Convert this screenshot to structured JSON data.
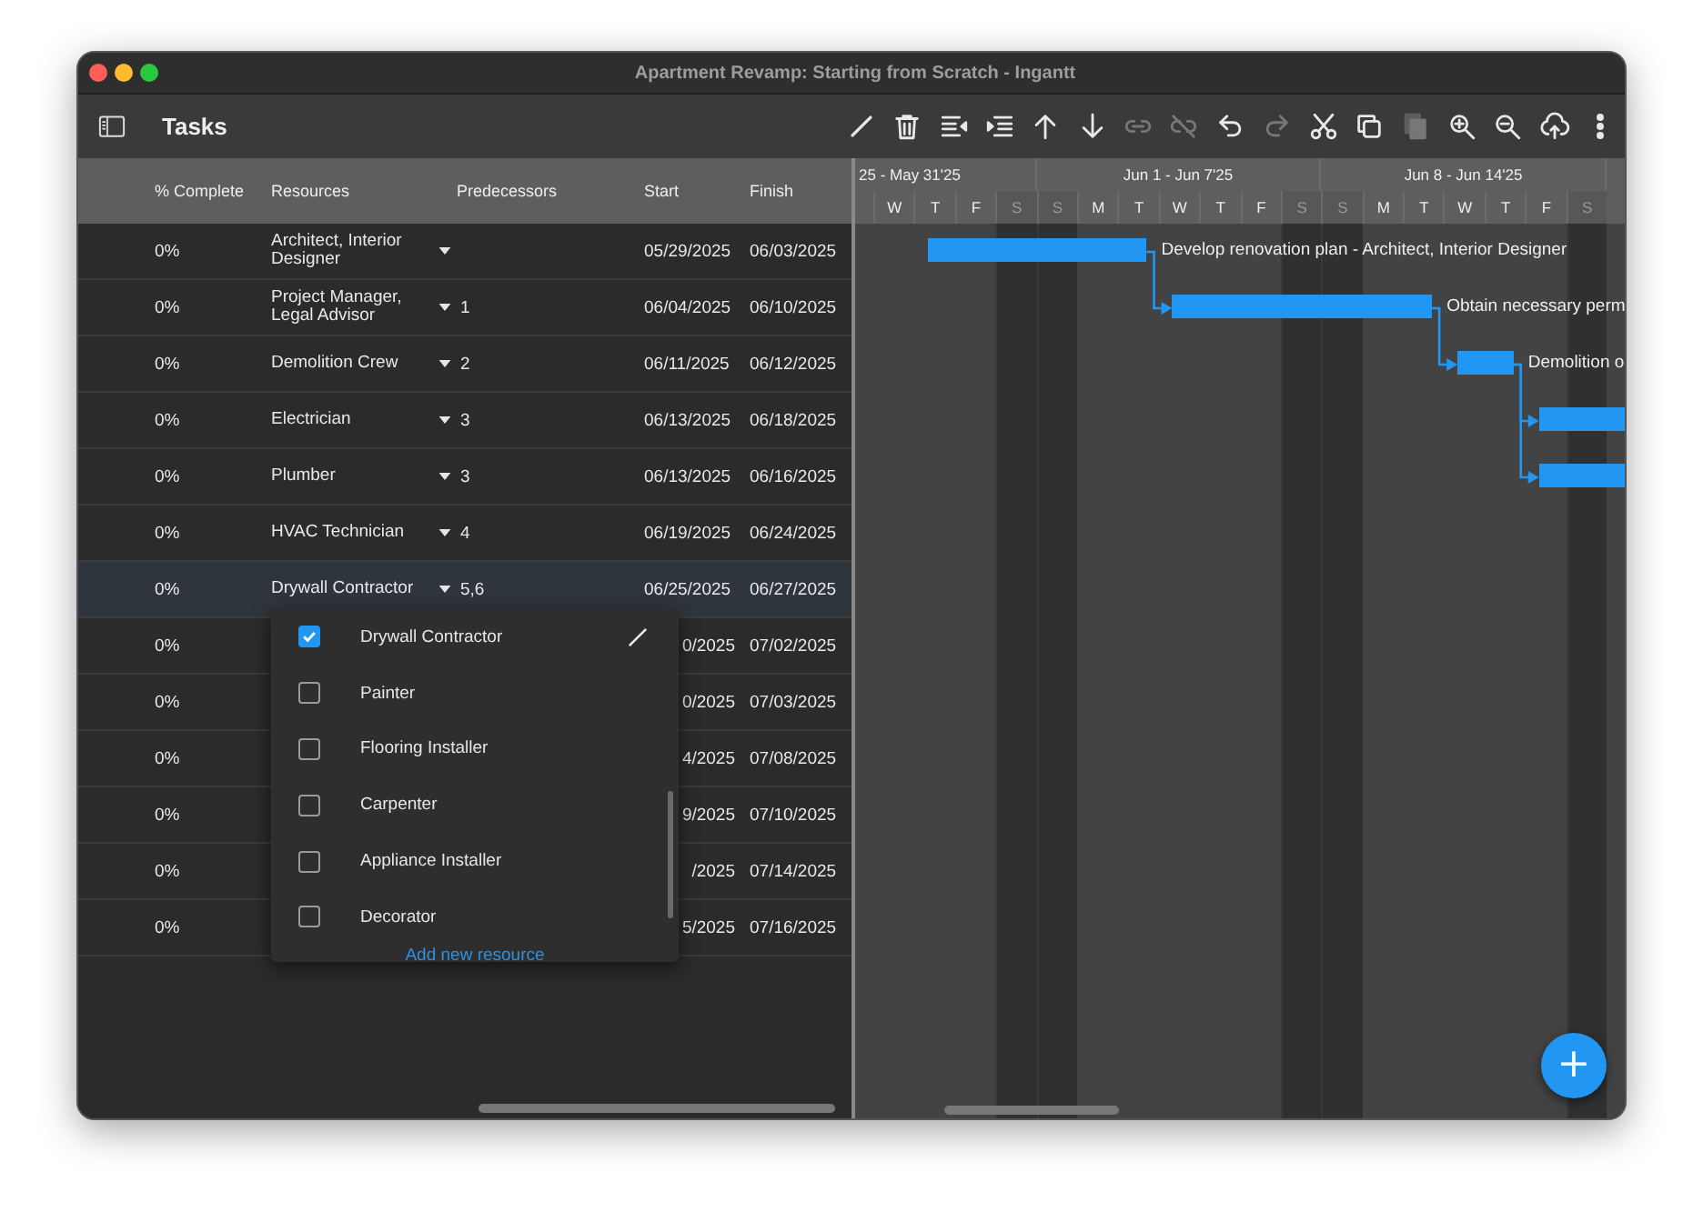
{
  "window": {
    "title": "Apartment Revamp: Starting from Scratch - Ingantt"
  },
  "toolbar": {
    "title": "Tasks",
    "tools": [
      {
        "disabled": false
      },
      {
        "disabled": false
      },
      {
        "disabled": false
      },
      {
        "disabled": false
      },
      {
        "disabled": false
      },
      {
        "disabled": false
      },
      {
        "disabled": true
      },
      {
        "disabled": true
      },
      {
        "disabled": false
      },
      {
        "disabled": true
      },
      {
        "disabled": false
      },
      {
        "disabled": false
      },
      {
        "disabled": true
      },
      {
        "disabled": false
      },
      {
        "disabled": false
      },
      {
        "disabled": false
      },
      {
        "disabled": false
      }
    ]
  },
  "table": {
    "columns": [
      "% Complete",
      "Resources",
      "Predecessors",
      "Start",
      "Finish"
    ],
    "rows": [
      {
        "complete": "0%",
        "resources": "Architect, Interior Designer",
        "predecessors": "",
        "start": "05/29/2025",
        "finish": "06/03/2025",
        "selected": false,
        "bar_label": "Develop renovation plan - Architect, Interior Designer"
      },
      {
        "complete": "0%",
        "resources": "Project Manager, Legal Advisor",
        "predecessors": "1",
        "start": "06/04/2025",
        "finish": "06/10/2025",
        "selected": false,
        "bar_label": "Obtain necessary perm"
      },
      {
        "complete": "0%",
        "resources": "Demolition Crew",
        "predecessors": "2",
        "start": "06/11/2025",
        "finish": "06/12/2025",
        "selected": false,
        "bar_label": "Demolition o"
      },
      {
        "complete": "0%",
        "resources": "Electrician",
        "predecessors": "3",
        "start": "06/13/2025",
        "finish": "06/18/2025",
        "selected": false
      },
      {
        "complete": "0%",
        "resources": "Plumber",
        "predecessors": "3",
        "start": "06/13/2025",
        "finish": "06/16/2025",
        "selected": false
      },
      {
        "complete": "0%",
        "resources": "HVAC Technician",
        "predecessors": "4",
        "start": "06/19/2025",
        "finish": "06/24/2025",
        "selected": false
      },
      {
        "complete": "0%",
        "resources": "Drywall Contractor",
        "predecessors": "5,6",
        "start": "06/25/2025",
        "finish": "06/27/2025",
        "selected": true
      },
      {
        "complete": "0%",
        "start_partial": "0/2025",
        "finish": "07/02/2025",
        "selected": false
      },
      {
        "complete": "0%",
        "start_partial": "0/2025",
        "finish": "07/03/2025",
        "selected": false
      },
      {
        "complete": "0%",
        "start_partial": "4/2025",
        "finish": "07/08/2025",
        "selected": false
      },
      {
        "complete": "0%",
        "start_partial": "9/2025",
        "finish": "07/10/2025",
        "selected": false
      },
      {
        "complete": "0%",
        "start_partial": "/2025",
        "finish": "07/14/2025",
        "selected": false
      },
      {
        "complete": "0%",
        "start_partial": "5/2025",
        "finish": "07/16/2025",
        "selected": false
      }
    ]
  },
  "resource_menu": {
    "items": [
      {
        "label": "Drywall Contractor",
        "checked": true,
        "hovered": true
      },
      {
        "label": "Painter",
        "checked": false,
        "hovered": false
      },
      {
        "label": "Flooring Installer",
        "checked": false,
        "hovered": false
      },
      {
        "label": "Carpenter",
        "checked": false,
        "hovered": false
      },
      {
        "label": "Appliance Installer",
        "checked": false,
        "hovered": false
      },
      {
        "label": "Decorator",
        "checked": false,
        "hovered": false
      }
    ],
    "add_link": "Add new resource"
  },
  "timeline": {
    "weeks": [
      "25 - May 31'25",
      "Jun 1 - Jun 7'25",
      "Jun 8 - Jun 14'25"
    ],
    "days": [
      {
        "label": "W",
        "weekend": false
      },
      {
        "label": "T",
        "weekend": false
      },
      {
        "label": "F",
        "weekend": false
      },
      {
        "label": "S",
        "weekend": true
      },
      {
        "label": "S",
        "weekend": true
      },
      {
        "label": "M",
        "weekend": false
      },
      {
        "label": "T",
        "weekend": false
      },
      {
        "label": "W",
        "weekend": false
      },
      {
        "label": "T",
        "weekend": false
      },
      {
        "label": "F",
        "weekend": false
      },
      {
        "label": "S",
        "weekend": true
      },
      {
        "label": "S",
        "weekend": true
      },
      {
        "label": "M",
        "weekend": false
      },
      {
        "label": "T",
        "weekend": false
      },
      {
        "label": "W",
        "weekend": false
      },
      {
        "label": "T",
        "weekend": false
      },
      {
        "label": "F",
        "weekend": false
      },
      {
        "label": "S",
        "weekend": true
      }
    ]
  },
  "add_button": "+"
}
